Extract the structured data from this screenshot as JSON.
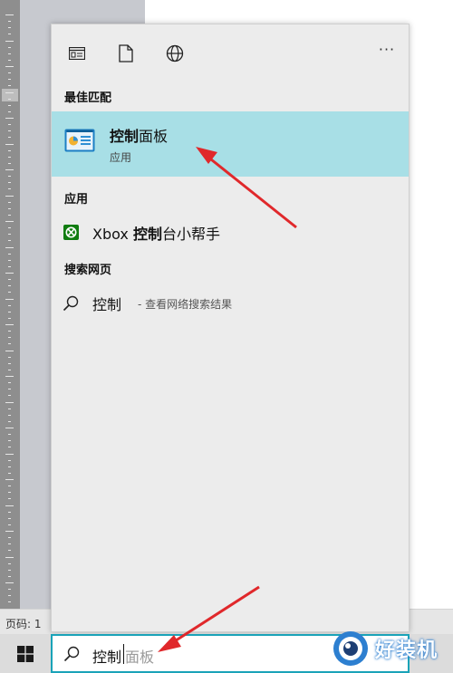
{
  "document": {
    "status_text": "页码: 1"
  },
  "search_panel": {
    "toolbar": {
      "icons": [
        "document-list-icon",
        "document-icon",
        "globe-icon"
      ],
      "more_label": "···"
    },
    "best_match": {
      "section_title": "最佳匹配",
      "item": {
        "icon": "control-panel-icon",
        "name_highlight": "控制",
        "name_rest": "面板",
        "subtitle": "应用"
      }
    },
    "apps": {
      "section_title": "应用",
      "item": {
        "icon": "xbox-icon",
        "name_prefix": "Xbox ",
        "name_highlight": "控制",
        "name_rest": "台小帮手"
      }
    },
    "web": {
      "section_title": "搜索网页",
      "item": {
        "icon": "search-icon",
        "term": "控制",
        "hint": "- 查看网络搜索结果"
      }
    }
  },
  "taskbar": {
    "start_icon": "windows-logo-icon",
    "search": {
      "typed": "控制",
      "suggestion": "面板"
    }
  },
  "watermark": {
    "text": "好装机"
  },
  "colors": {
    "highlight": "#a8dfe6",
    "search_border": "#1aa3b8",
    "annotation_arrow": "#e0282b",
    "xbox_green": "#107c10"
  }
}
